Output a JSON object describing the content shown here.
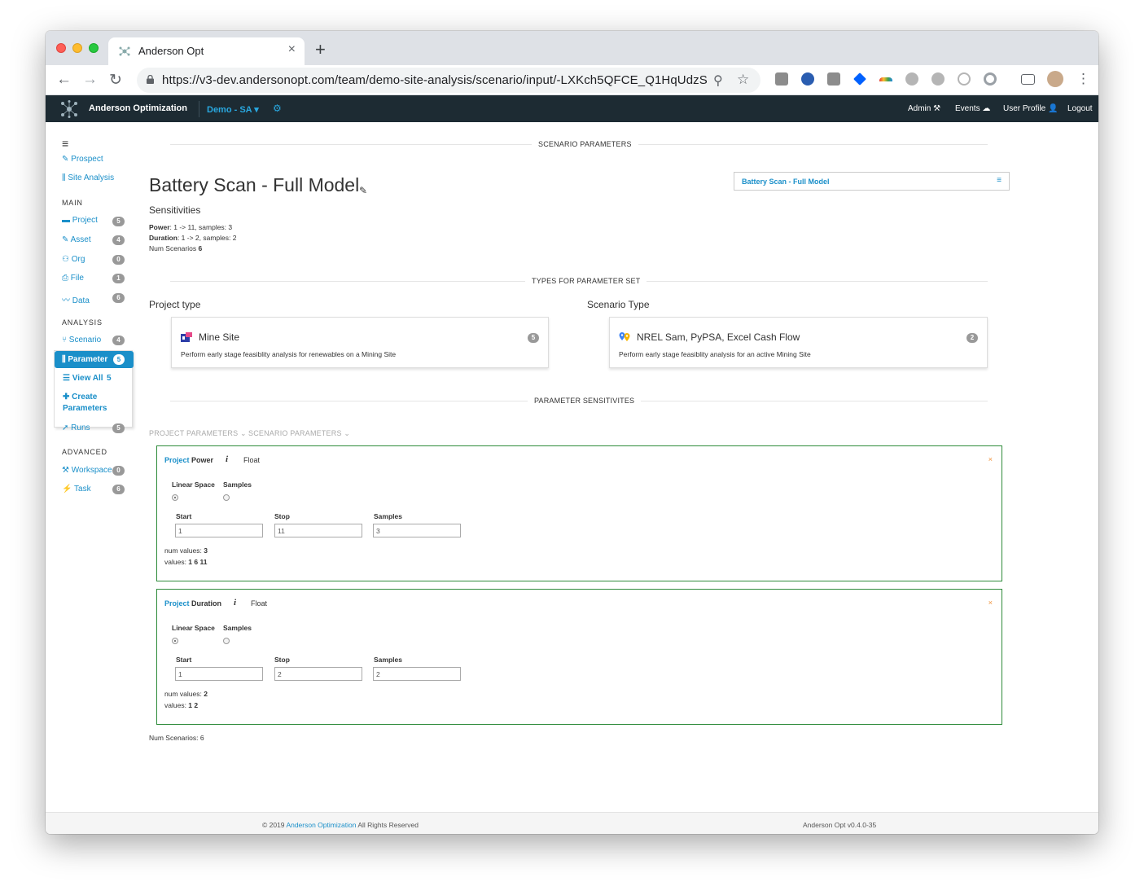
{
  "browser": {
    "tab_title": "Anderson Opt",
    "tab_close": "×",
    "new_tab": "+",
    "url": "https://v3-dev.andersonopt.com/team/demo-site-analysis/scenario/input/-LXKch5QFCE_Q1HqUdzS",
    "back": "←",
    "forward": "→",
    "reload": "↻",
    "zoom": "⚲",
    "star": "☆",
    "menu": "⋮"
  },
  "appbar": {
    "brand": "Anderson Optimization",
    "team": "Demo - SA ▾",
    "gear": "⚙",
    "admin": "Admin ⚒",
    "events": "Events ☁",
    "profile": "User Profile 👤",
    "logout": "Logout"
  },
  "sidebar": {
    "menu_icon": "≡",
    "prospect": "✎ Prospect",
    "site_analysis": "⫼ Site Analysis",
    "main_heading": "MAIN",
    "project": "▬ Project",
    "project_count": "5",
    "asset": "✎ Asset",
    "asset_count": "4",
    "org": "⚇ Org",
    "org_count": "0",
    "file": "⎙ File",
    "file_count": "1",
    "data": "〰 Data",
    "data_count": "6",
    "analysis_heading": "ANALYSIS",
    "scenario": "⑂ Scenario",
    "scenario_count": "4",
    "parameter": "⫼ Parameter",
    "parameter_count": "5",
    "view_all": "☰ View All",
    "view_all_count": "5",
    "create_parameters_1": "✚ Create",
    "create_parameters_2": "Parameters",
    "runs": "➚ Runs",
    "runs_count": "5",
    "advanced_heading": "ADVANCED",
    "workspace": "⚒ Workspace",
    "workspace_count": "0",
    "task": "⚡ Task",
    "task_count": "6"
  },
  "main": {
    "scenario_parameters_header": "SCENARIO PARAMETERS",
    "title": "Battery Scan - Full Model",
    "edit_icon": "✎",
    "scenario_select": "Battery Scan - Full Model",
    "scenario_select_icon": "≡",
    "sensitivities_heading": "Sensitivities",
    "power_label": "Power",
    "power_text": ": 1 -> 11, samples: 3",
    "duration_label": "Duration",
    "duration_text": ": 1 -> 2, samples: 2",
    "num_scenarios_label": "Num Scenarios ",
    "num_scenarios_value": "6",
    "types_header": "TYPES FOR PARAMETER SET",
    "project_type_heading": "Project type",
    "scenario_type_heading": "Scenario Type",
    "project_type": {
      "name": "Mine Site",
      "desc": "Perform early stage feasiblity analysis for renewables on a Mining Site",
      "badge": "5"
    },
    "scenario_type": {
      "name": "NREL Sam, PyPSA, Excel Cash Flow",
      "desc": "Perform early stage feasiblity analysis for an active Mining Site",
      "badge": "2"
    },
    "sensitivities_header": "PARAMETER SENSITIVITES",
    "project_params_dropdown": "PROJECT PARAMETERS ⌄",
    "scenario_params_dropdown": "SCENARIO PARAMETERS ⌄",
    "params": [
      {
        "prefix": "Project",
        "name": " Power",
        "info": "i",
        "type": "Float",
        "close": "×",
        "linear_label": "Linear Space",
        "samples_label": "Samples",
        "start_label": "Start",
        "stop_label": "Stop",
        "samples_field_label": "Samples",
        "start": "1",
        "stop": "11",
        "samples": "3",
        "num_values_label": "num values: ",
        "num_values": "3",
        "values_label": "values: ",
        "values": "1 6 11"
      },
      {
        "prefix": "Project",
        "name": " Duration",
        "info": "i",
        "type": "Float",
        "close": "×",
        "linear_label": "Linear Space",
        "samples_label": "Samples",
        "start_label": "Start",
        "stop_label": "Stop",
        "samples_field_label": "Samples",
        "start": "1",
        "stop": "2",
        "samples": "2",
        "num_values_label": "num values: ",
        "num_values": "2",
        "values_label": "values: ",
        "values": "1 2"
      }
    ],
    "footer_num_scenarios": "Num Scenarios: 6"
  },
  "footer": {
    "copyright_prefix": "© 2019 ",
    "company": "Anderson Optimization",
    "rights": " All Rights Reserved",
    "version": "Anderson Opt v0.4.0-35"
  }
}
